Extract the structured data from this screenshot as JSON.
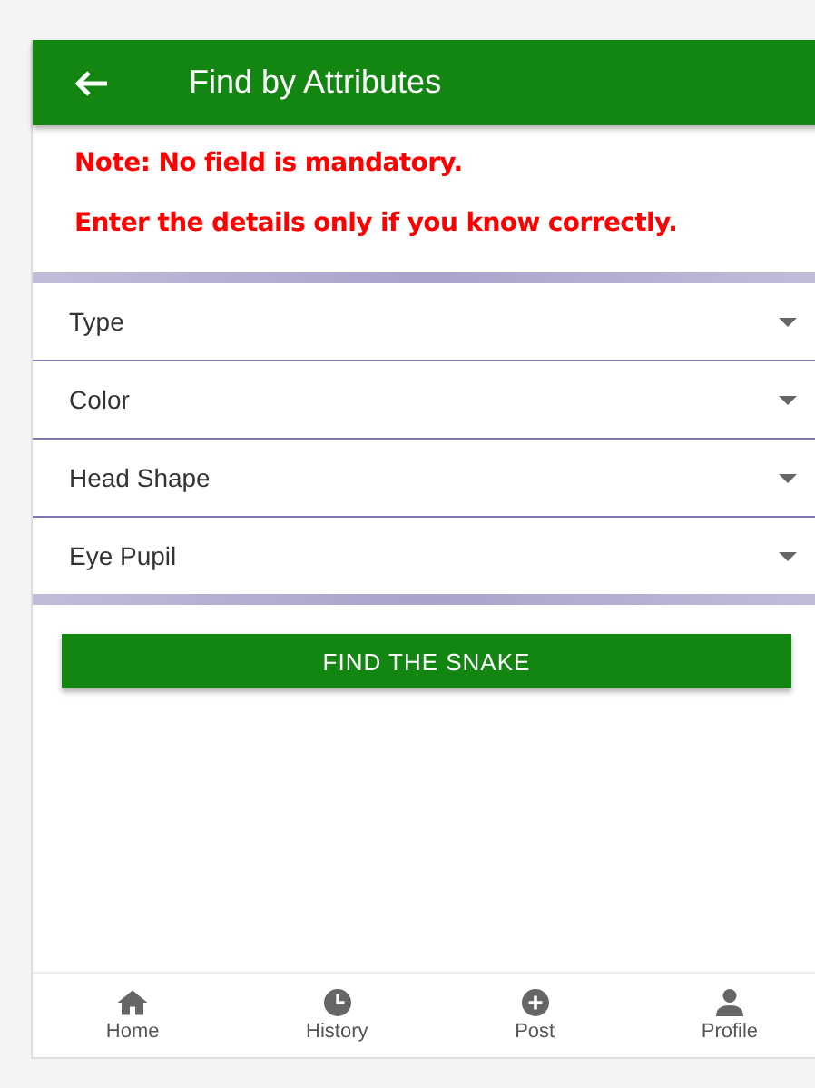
{
  "header": {
    "title": "Find by Attributes"
  },
  "notes": [
    "Note: No field is mandatory.",
    "Enter the details only if you know correctly."
  ],
  "fields": [
    {
      "label": "Type"
    },
    {
      "label": "Color"
    },
    {
      "label": "Head Shape"
    },
    {
      "label": "Eye Pupil"
    }
  ],
  "action_button": "FIND THE SNAKE",
  "bottom_nav": [
    {
      "label": "Home",
      "kind": "home"
    },
    {
      "label": "History",
      "kind": "history"
    },
    {
      "label": "Post",
      "kind": "post"
    },
    {
      "label": "Profile",
      "kind": "profile"
    }
  ]
}
